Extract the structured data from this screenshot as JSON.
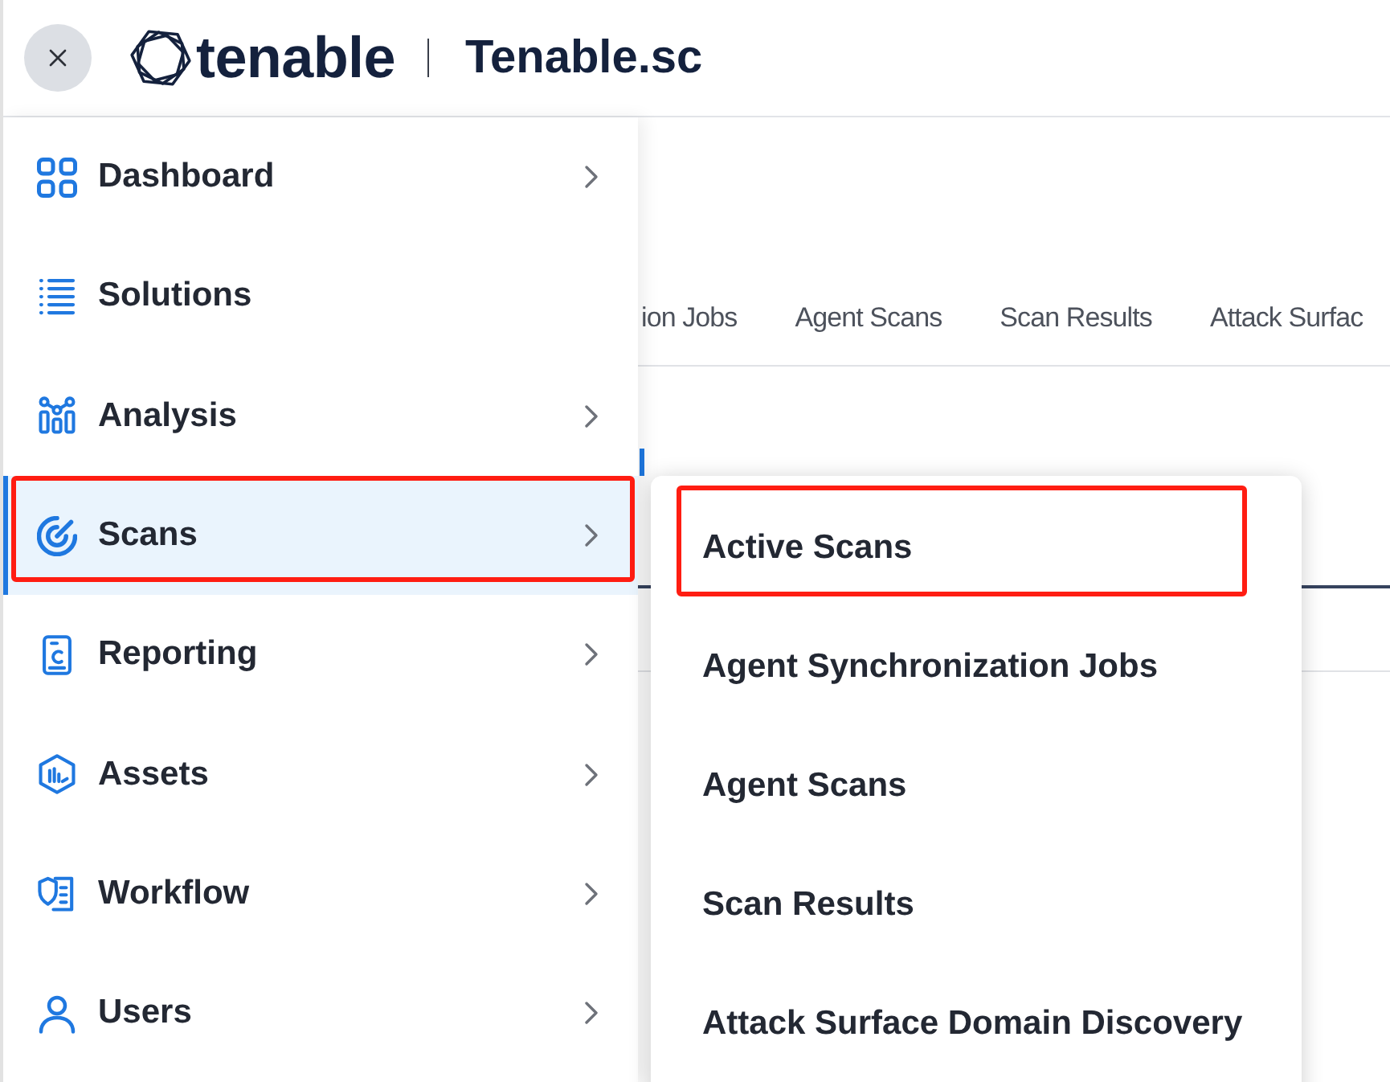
{
  "header": {
    "logo": {
      "wordmark": "tenable"
    },
    "product": "Tenable.sc"
  },
  "sidebar": {
    "items": [
      {
        "label": "Dashboard",
        "has_submenu": true,
        "selected": false,
        "highlighted": false
      },
      {
        "label": "Solutions",
        "has_submenu": false,
        "selected": false,
        "highlighted": false
      },
      {
        "label": "Analysis",
        "has_submenu": true,
        "selected": false,
        "highlighted": false
      },
      {
        "label": "Scans",
        "has_submenu": true,
        "selected": true,
        "highlighted": true
      },
      {
        "label": "Reporting",
        "has_submenu": true,
        "selected": false,
        "highlighted": false
      },
      {
        "label": "Assets",
        "has_submenu": true,
        "selected": false,
        "highlighted": false
      },
      {
        "label": "Workflow",
        "has_submenu": true,
        "selected": false,
        "highlighted": false
      },
      {
        "label": "Users",
        "has_submenu": true,
        "selected": false,
        "highlighted": false
      }
    ]
  },
  "background_page": {
    "tabs": [
      {
        "label": "ion Jobs"
      },
      {
        "label": "Agent Scans"
      },
      {
        "label": "Scan Results"
      },
      {
        "label": "Attack Surfac"
      }
    ]
  },
  "submenu": {
    "items": [
      {
        "label": "Active Scans",
        "highlighted": true
      },
      {
        "label": "Agent Synchronization Jobs",
        "highlighted": false
      },
      {
        "label": "Agent Scans",
        "highlighted": false
      },
      {
        "label": "Scan Results",
        "highlighted": false
      },
      {
        "label": "Attack Surface Domain Discovery",
        "highlighted": false
      }
    ]
  }
}
